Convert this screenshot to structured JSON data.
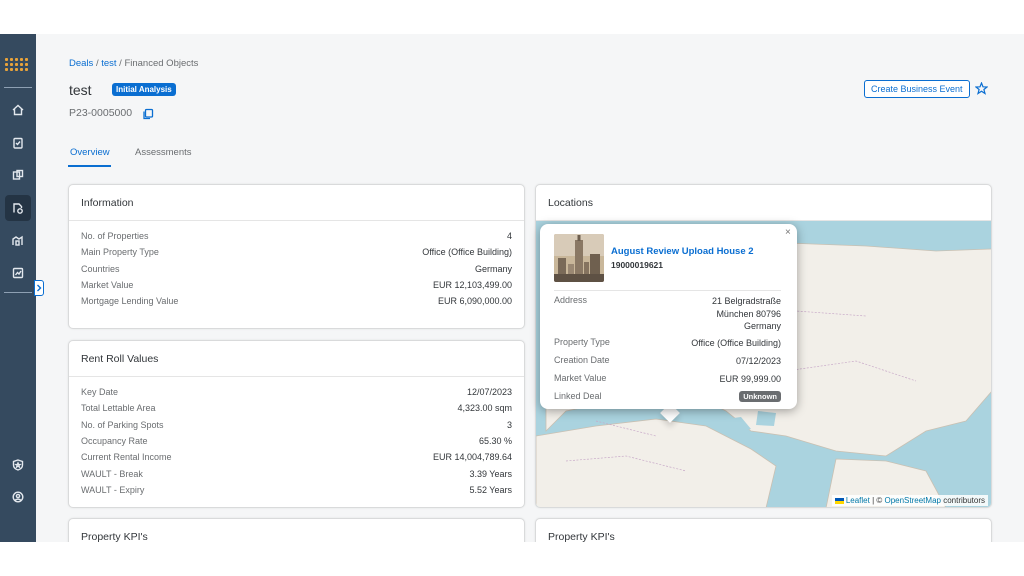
{
  "breadcrumb": {
    "deals": "Deals",
    "test": "test",
    "current": "Financed Objects",
    "sep": "/"
  },
  "header": {
    "title": "test",
    "status": "Initial Analysis",
    "object_id": "P23-0005000",
    "create_button": "Create Business Event"
  },
  "tabs": [
    {
      "label": "Overview",
      "selected": true
    },
    {
      "label": "Assessments",
      "selected": false
    }
  ],
  "information": {
    "title": "Information",
    "rows": [
      {
        "label": "No. of Properties",
        "value": "4"
      },
      {
        "label": "Main Property Type",
        "value": "Office (Office Building)"
      },
      {
        "label": "Countries",
        "value": "Germany"
      },
      {
        "label": "Market Value",
        "value": "EUR 12,103,499.00"
      },
      {
        "label": "Mortgage Lending Value",
        "value": "EUR 6,090,000.00"
      }
    ]
  },
  "rent_roll": {
    "title": "Rent Roll Values",
    "rows": [
      {
        "label": "Key Date",
        "value": "12/07/2023"
      },
      {
        "label": "Total Lettable Area",
        "value": "4,323.00 sqm"
      },
      {
        "label": "No. of Parking Spots",
        "value": "3"
      },
      {
        "label": "Occupancy Rate",
        "value": "65.30 %"
      },
      {
        "label": "Current Rental Income",
        "value": "EUR 14,004,789.64"
      },
      {
        "label": "WAULT - Break",
        "value": "3.39 Years"
      },
      {
        "label": "WAULT - Expiry",
        "value": "5.52 Years"
      }
    ]
  },
  "locations": {
    "title": "Locations",
    "attribution": {
      "leaflet": "Leaflet",
      "sep": " | © ",
      "osm": "OpenStreetMap",
      "suffix": " contributors"
    },
    "popup": {
      "close": "×",
      "title": "August Review Upload House 2",
      "subtitle": "19000019621",
      "address_label": "Address",
      "address_line1": "21 Belgradstraße",
      "address_line2": "München 80796",
      "address_line3": "Germany",
      "property_type_label": "Property Type",
      "property_type": "Office (Office Building)",
      "creation_date_label": "Creation Date",
      "creation_date": "07/12/2023",
      "market_value_label": "Market Value",
      "market_value": "EUR 99,999.00",
      "linked_deal_label": "Linked Deal",
      "linked_deal": "Unknown"
    }
  },
  "kpi_left": {
    "title": "Property KPI's"
  },
  "kpi_right": {
    "title": "Property KPI's"
  },
  "colors": {
    "shell": "#354a5f",
    "accent": "#0a6ed1",
    "background": "#f5f6f7",
    "map_water": "#aad3df",
    "map_land": "#f2efe9"
  }
}
